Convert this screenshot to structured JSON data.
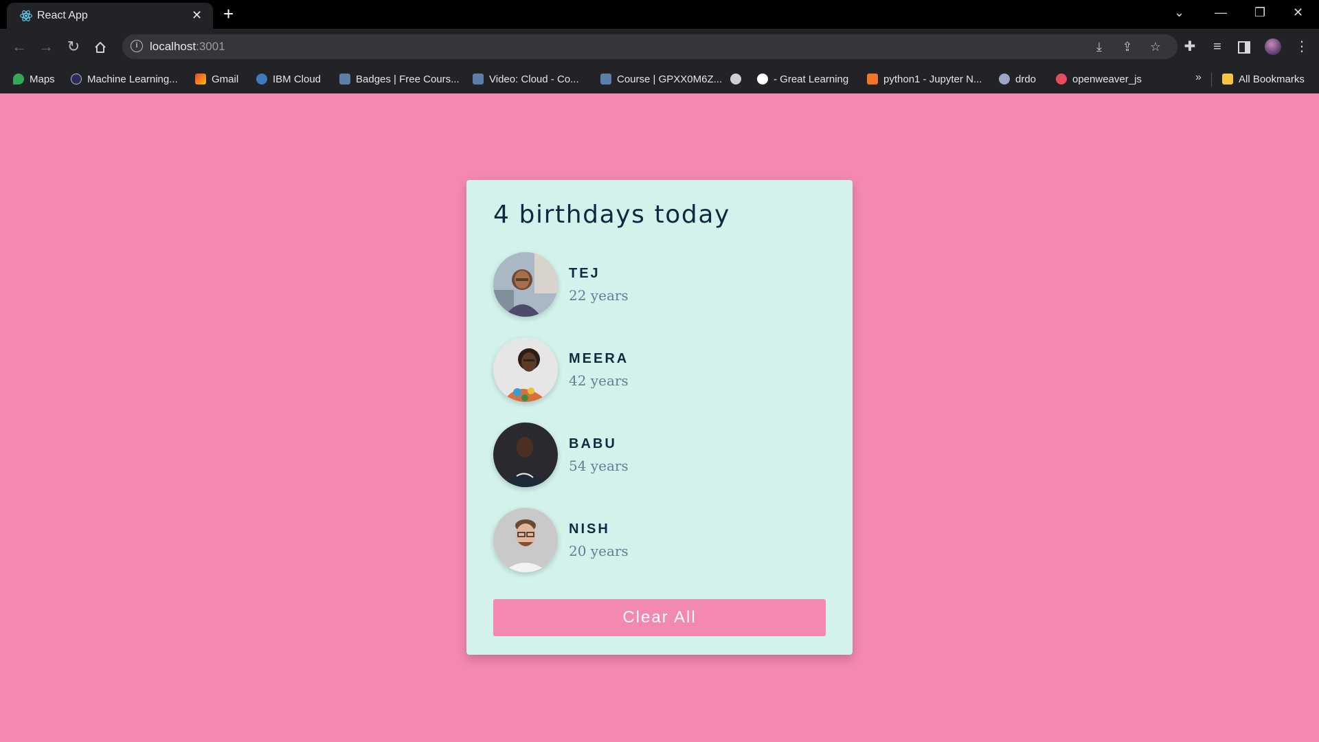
{
  "browser": {
    "tab_title": "React App",
    "url_host": "localhost",
    "url_port": ":3001",
    "bookmarks": [
      {
        "label": "Maps",
        "icon": "maps-icon",
        "color": "#34a853"
      },
      {
        "label": "Machine Learning...",
        "icon": "ml-icon",
        "color": "#6a5acd"
      },
      {
        "label": "Gmail",
        "icon": "gmail-icon",
        "color": "#ea4335"
      },
      {
        "label": "IBM Cloud",
        "icon": "ibm-cloud-icon",
        "color": "#4178be"
      },
      {
        "label": "Badges | Free Cours...",
        "icon": "badge-icon",
        "color": "#5b7fa6"
      },
      {
        "label": "Video: Cloud - Co...",
        "icon": "video-icon",
        "color": "#5b7fa6"
      },
      {
        "label": "Course | GPXX0M6Z...",
        "icon": "course-icon",
        "color": "#5b7fa6"
      },
      {
        "label": "",
        "icon": "globe-icon",
        "color": "#cfcfcf"
      },
      {
        "label": "- Great Learning",
        "icon": "google-icon",
        "color": "#ffffff"
      },
      {
        "label": "python1 - Jupyter N...",
        "icon": "jupyter-icon",
        "color": "#f37626"
      },
      {
        "label": "drdo",
        "icon": "drdo-icon",
        "color": "#9aa7c7"
      },
      {
        "label": "openweaver_js",
        "icon": "openweaver-icon",
        "color": "#e84a5f"
      }
    ],
    "more_label": "»",
    "all_bookmarks": "All Bookmarks"
  },
  "card": {
    "title": "4 birthdays today",
    "people": [
      {
        "name": "TEJ",
        "age": "22 years"
      },
      {
        "name": "MEERA",
        "age": "42 years"
      },
      {
        "name": "BABU",
        "age": "54 years"
      },
      {
        "name": "NISH",
        "age": "20 years"
      }
    ],
    "clear_label": "Clear All"
  },
  "colors": {
    "page_bg": "#f388b0",
    "card_bg": "#d2f2eb",
    "name_color": "#102a43",
    "age_color": "#627d98"
  }
}
